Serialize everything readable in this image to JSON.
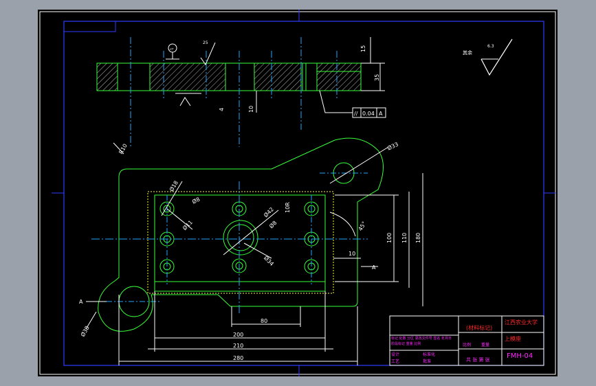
{
  "colors": {
    "background": "#000000",
    "frame": "#ffffff",
    "border": "#2f3cff",
    "part": "#39ff3a",
    "centerline": "#1fa3ff",
    "dim": "#ffffff",
    "red": "#ff2a2a",
    "magenta": "#ff2aff",
    "yellow": "#ffff33"
  },
  "section_view": {
    "flatness_symbol": "▱",
    "roughness_value": "25",
    "tolerance_symbol": "//",
    "tolerance_value": "0.04",
    "datum": "A",
    "dims": {
      "top_gap": "15",
      "height": "35",
      "bottom_step": "10",
      "small_step": "4"
    }
  },
  "roughness_note": {
    "label": "其余",
    "value": "6.3"
  },
  "plan_view": {
    "dims": {
      "r10": "R10",
      "phi33": "Ø33",
      "phi18": "Ø18",
      "phi8": "Ø8",
      "phi11": "Ø11",
      "phi42": "Ø42",
      "phi8b": "Ø8",
      "phi34": "Ø34",
      "r10b": "10R",
      "angle45": "45°",
      "h100": "100",
      "h110": "110",
      "h180": "180",
      "l10": "10",
      "phi38": "Ø38",
      "l80": "80",
      "l200": "200",
      "l210": "210",
      "l280": "280",
      "section_a_left": "A",
      "section_a_right": "A"
    }
  },
  "title_block": {
    "material_mark": "(材料标记)",
    "school": "江西农业大学",
    "part_name": "上模座",
    "drawing_no": "FMH-04",
    "ratio_label": "比例",
    "scale_label": "重量",
    "sheet_label": "共 张 第 张",
    "designer": "设计",
    "process": "工艺",
    "approve": "批准",
    "standard": "标准化",
    "design_row": "标记 处数 分区 更改文件号 签名 年月日",
    "stage_row": "阶段标记 重量 比例"
  }
}
